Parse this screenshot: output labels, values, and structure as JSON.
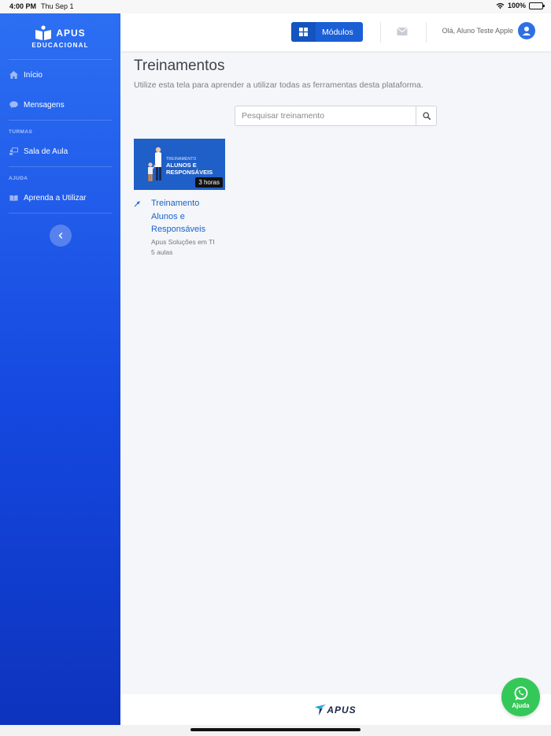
{
  "status_bar": {
    "time": "4:00 PM",
    "date": "Thu Sep 1",
    "battery": "100%"
  },
  "brand": {
    "name": "APUS",
    "subtitle": "EDUCACIONAL"
  },
  "sidebar": {
    "items": [
      {
        "label": "Início",
        "icon": "home-icon"
      },
      {
        "label": "Mensagens",
        "icon": "chat-icon"
      }
    ],
    "sections": [
      {
        "heading": "TURMAS",
        "items": [
          {
            "label": "Sala de Aula",
            "icon": "classroom-icon"
          }
        ]
      },
      {
        "heading": "AJUDA",
        "items": [
          {
            "label": "Aprenda a Utilizar",
            "icon": "book-icon"
          }
        ]
      }
    ]
  },
  "topbar": {
    "modules_label": "Módulos",
    "greeting": "Olá, Aluno Teste Apple"
  },
  "main": {
    "title": "Treinamentos",
    "description": "Utilize esta tela para aprender a utilizar todas as ferramentas desta plataforma.",
    "search_placeholder": "Pesquisar treinamento",
    "cards": [
      {
        "thumb_line1": "TREINAMENTO",
        "thumb_line2": "ALUNOS E",
        "thumb_line3": "RESPONSÁVEIS",
        "duration": "3 horas",
        "title_line1": "Treinamento",
        "title_line2": "Alunos e",
        "title_line3": "Responsáveis",
        "author": "Apus Soluções em TI",
        "lessons": "5 aulas"
      }
    ]
  },
  "footer": {
    "logo_text": "APUS"
  },
  "whatsapp": {
    "label": "Ajuda"
  },
  "colors": {
    "sidebar_top": "#2c6ff3",
    "sidebar_bottom": "#0d33bd",
    "accent": "#1a5fd6",
    "whatsapp": "#34c859"
  }
}
